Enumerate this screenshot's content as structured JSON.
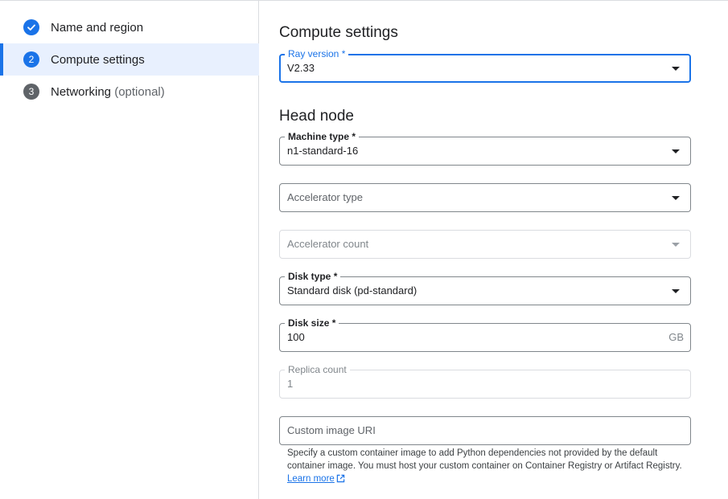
{
  "stepper": {
    "steps": [
      {
        "number": "1",
        "label": "Name and region",
        "optional": "",
        "state": "done"
      },
      {
        "number": "2",
        "label": "Compute settings",
        "optional": "",
        "state": "current"
      },
      {
        "number": "3",
        "label": "Networking",
        "optional": "(optional)",
        "state": "pending"
      }
    ]
  },
  "main": {
    "title": "Compute settings",
    "ray_version": {
      "label": "Ray version *",
      "value": "V2.33"
    },
    "head_node": {
      "title": "Head node",
      "machine_type": {
        "label": "Machine type *",
        "value": "n1-standard-16"
      },
      "accelerator_type": {
        "placeholder": "Accelerator type"
      },
      "accelerator_count": {
        "placeholder": "Accelerator count"
      },
      "disk_type": {
        "label": "Disk type *",
        "value": "Standard disk (pd-standard)"
      },
      "disk_size": {
        "label": "Disk size *",
        "value": "100",
        "unit": "GB"
      },
      "replica_count": {
        "label": "Replica count",
        "value": "1"
      },
      "custom_image": {
        "placeholder": "Custom image URI",
        "helper_text": "Specify a custom container image to add Python dependencies not provided by the default container image. You must host your custom container on Container Registry or Artifact Registry.",
        "learn_more": "Learn more"
      }
    }
  },
  "colors": {
    "accent": "#1a73e8",
    "border": "#80868b",
    "muted": "#5f6368"
  }
}
